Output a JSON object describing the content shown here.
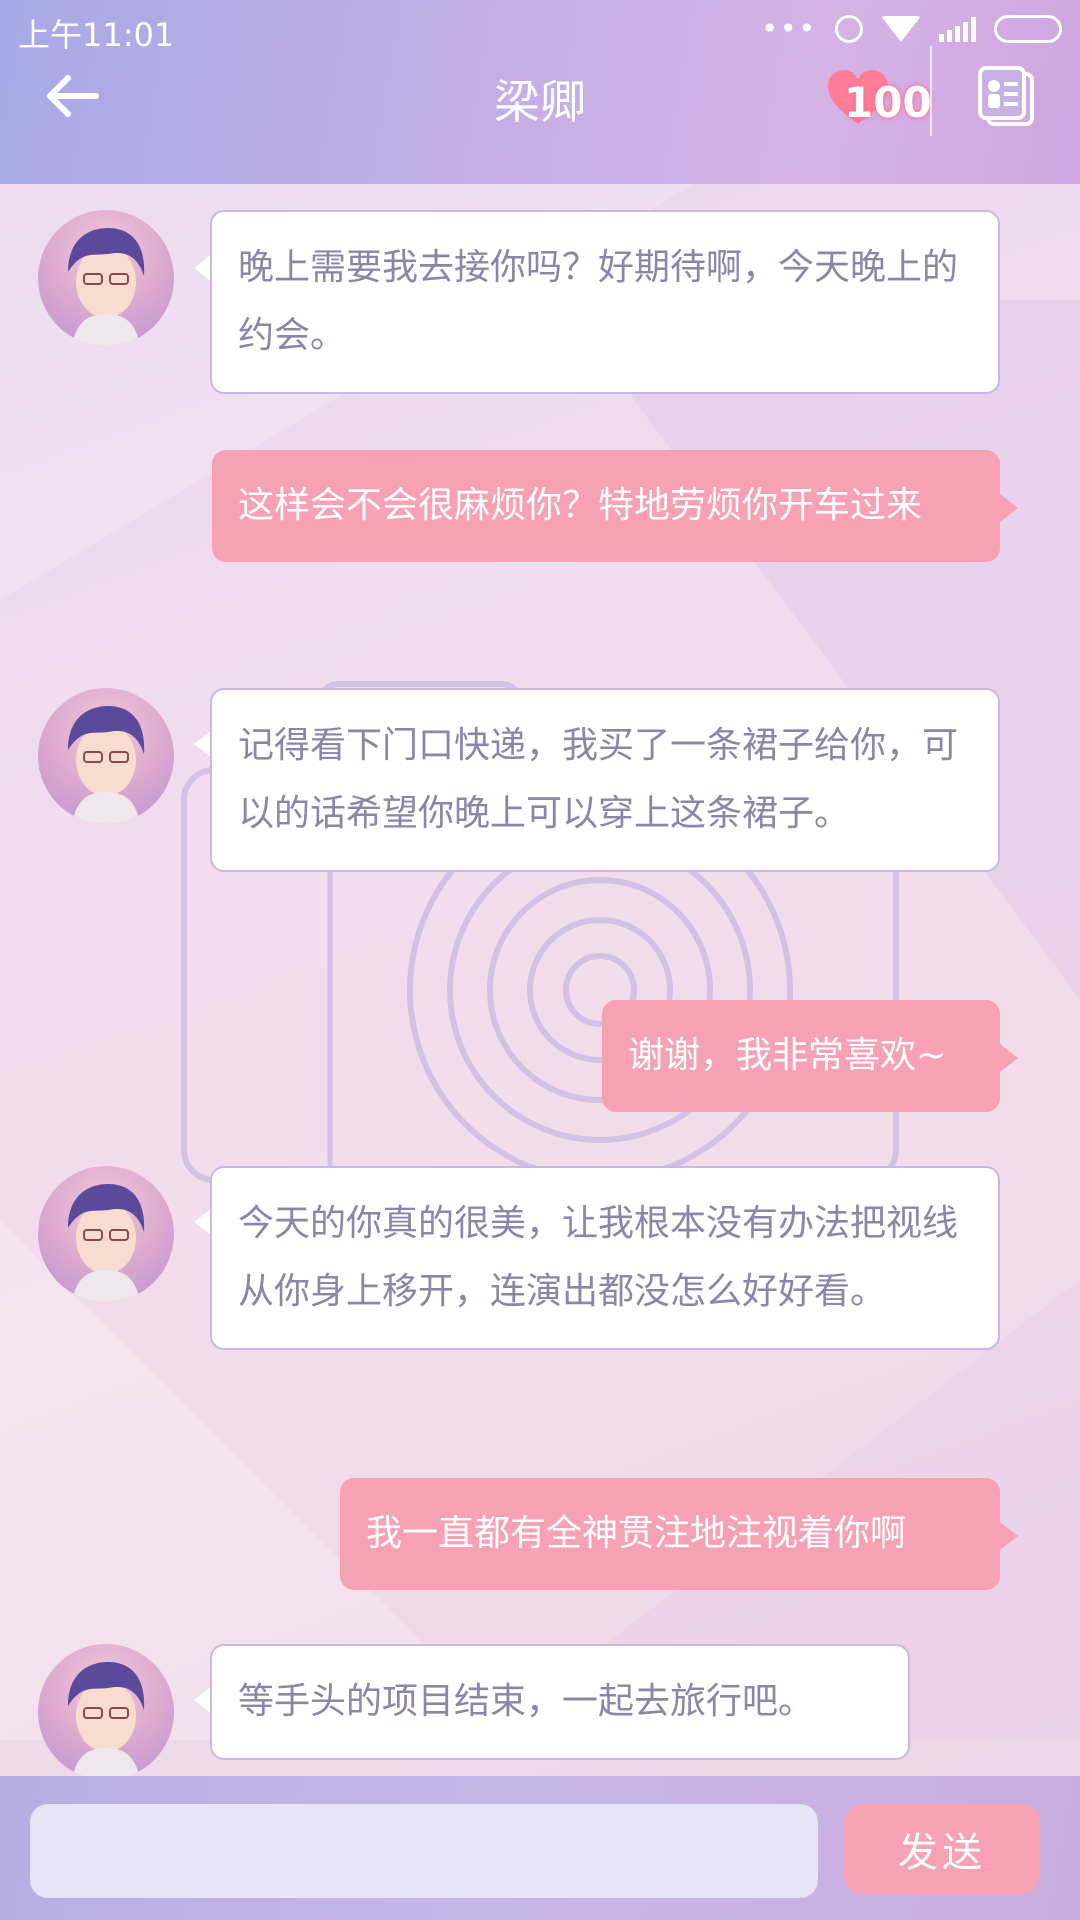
{
  "status_bar": {
    "time": "上午11:01",
    "icons": [
      "more-dots-icon",
      "alarm-icon",
      "wifi-icon",
      "signal-icon",
      "battery-icon"
    ]
  },
  "header": {
    "title": "梁卿",
    "affection_value": "100",
    "back_icon": "back-arrow-icon",
    "profile_icon": "contact-card-icon"
  },
  "colors": {
    "incoming_bg": "#ffffff",
    "incoming_text": "#8a86a8",
    "outgoing_bg": "#f7a1b5",
    "outgoing_text": "#ffffff",
    "header_gradient_start": "#a7a9e6",
    "header_gradient_end": "#cfa6df"
  },
  "messages": [
    {
      "from": "contact",
      "text": "晚上需要我去接你吗？好期待啊，今天晚上的约会。"
    },
    {
      "from": "me",
      "text": "这样会不会很麻烦你？特地劳烦你开车过来"
    },
    {
      "from": "contact",
      "text": "记得看下门口快递，我买了一条裙子给你，可以的话希望你晚上可以穿上这条裙子。"
    },
    {
      "from": "me",
      "text": "谢谢，我非常喜欢~"
    },
    {
      "from": "contact",
      "text": "今天的你真的很美，让我根本没有办法把视线从你身上移开，连演出都没怎么好好看。"
    },
    {
      "from": "me",
      "text": "我一直都有全神贯注地注视着你啊"
    },
    {
      "from": "contact",
      "text": "等手头的项目结束，一起去旅行吧。"
    }
  ],
  "composer": {
    "input_value": "",
    "send_label": "发送"
  }
}
